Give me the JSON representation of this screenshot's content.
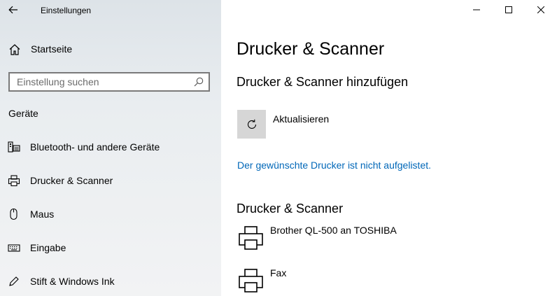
{
  "window": {
    "title": "Einstellungen",
    "controls": {
      "minimize": "minimize-icon",
      "maximize": "maximize-icon",
      "close": "close-icon"
    }
  },
  "sidebar": {
    "back_icon": "back-arrow-icon",
    "home": {
      "label": "Startseite",
      "icon": "home-icon"
    },
    "search": {
      "placeholder": "Einstellung suchen",
      "value": "",
      "icon": "search-icon"
    },
    "section_title": "Geräte",
    "items": [
      {
        "label": "Bluetooth- und andere Geräte",
        "icon": "bluetooth-devices-icon"
      },
      {
        "label": "Drucker & Scanner",
        "icon": "printer-icon"
      },
      {
        "label": "Maus",
        "icon": "mouse-icon"
      },
      {
        "label": "Eingabe",
        "icon": "keyboard-icon"
      },
      {
        "label": "Stift & Windows Ink",
        "icon": "pen-icon"
      }
    ]
  },
  "main": {
    "title": "Drucker & Scanner",
    "add_section_title": "Drucker & Scanner hinzufügen",
    "refresh": {
      "label": "Aktualisieren",
      "icon": "refresh-icon"
    },
    "not_listed_link": "Der gewünschte Drucker ist nicht aufgelistet.",
    "list_section_title": "Drucker & Scanner",
    "devices": [
      {
        "name": "Brother QL-500 an TOSHIBA",
        "icon": "printer-icon"
      },
      {
        "name": "Fax",
        "icon": "printer-icon"
      }
    ],
    "colors": {
      "link": "#0067b8",
      "tile": "#d6d6d6"
    }
  }
}
